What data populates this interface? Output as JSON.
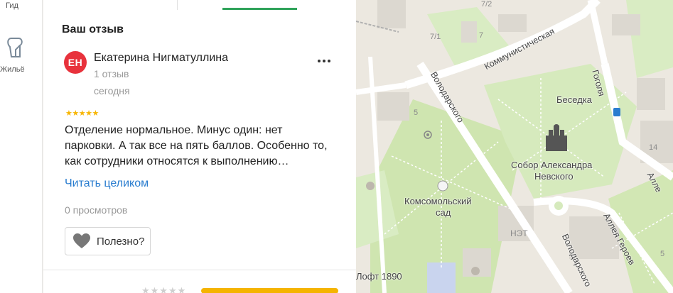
{
  "nav": {
    "guide_label": "Гид",
    "home_label": "Жильё"
  },
  "review": {
    "section_title": "Ваш отзыв",
    "avatar_initials": "ЕН",
    "author_name": "Екатерина Нигматуллина",
    "author_reviews": "1 отзыв",
    "date": "сегодня",
    "rating": 5,
    "stars": "★★★★★",
    "text": "Отделение нормальное. Минус один: нет парковки. А так все на пять баллов. Особенно то, как сотрудники относятся к выполнению…",
    "read_more": "Читать целиком",
    "views": "0 просмотров",
    "useful_label": "Полезно?",
    "more_menu": "⋯"
  },
  "bottom_rating": {
    "stars": "★★★★★"
  },
  "map": {
    "streets": {
      "kommunisticheskaya": "Коммунистическая",
      "volodarskogo_1": "Володарского",
      "volodarskogo_2": "Володарского",
      "gogolya": "Гоголя",
      "alleya_geroev": "Аллея Героев",
      "alleya_2": "Алле"
    },
    "pois": {
      "besedka": "Беседка",
      "sobor": "Собор Александра Невского",
      "sobor_line1": "Собор Александра",
      "sobor_line2": "Невского",
      "sad_line1": "Комсомольский",
      "sad_line2": "сад",
      "net": "НЭТ",
      "loft": "Лофт 1890"
    },
    "house_numbers": [
      "7/2",
      "7/1",
      "7",
      "5",
      "14",
      "5"
    ]
  }
}
